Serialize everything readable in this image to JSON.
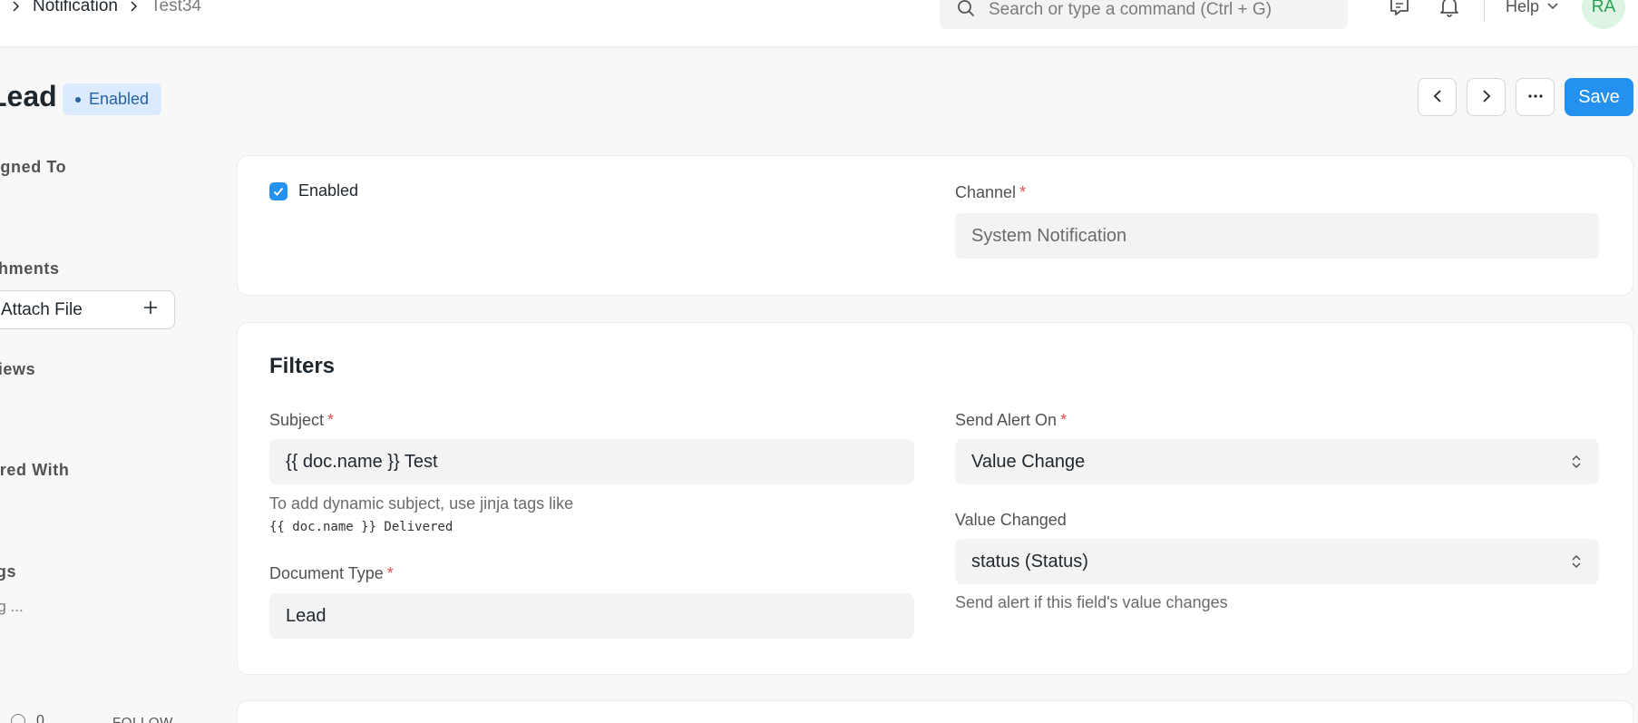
{
  "navbar": {
    "breadcrumb": [
      "Notification",
      "Test34"
    ],
    "search_placeholder": "Search or type a command (Ctrl + G)",
    "help_label": "Help",
    "avatar_initials": "RA"
  },
  "header": {
    "title": "Lead",
    "status": "Enabled"
  },
  "sidebar": {
    "assigned_to": "Assigned To",
    "attachments": "Attachments",
    "attach_file": "Attach File",
    "reviews": "Reviews",
    "shared_with": "Shared With",
    "tags": "Tags",
    "add_tag": "Add a tag ...",
    "like_count": "0",
    "follow": "FOLLOW"
  },
  "actions": {
    "save": "Save"
  },
  "general": {
    "enabled_label": "Enabled",
    "enabled_checked": true,
    "channel_label": "Channel",
    "channel_value": "System Notification"
  },
  "filters": {
    "title": "Filters",
    "subject_label": "Subject",
    "subject_value": "{{ doc.name }} Test",
    "subject_help": "To add dynamic subject, use jinja tags like",
    "subject_example": "{{ doc.name }} Delivered",
    "doctype_label": "Document Type",
    "doctype_value": "Lead",
    "send_alert_label": "Send Alert On",
    "send_alert_value": "Value Change",
    "value_changed_label": "Value Changed",
    "value_changed_value": "status (Status)",
    "value_changed_help": "Send alert if this field's value changes"
  },
  "colors": {
    "primary": "#2490ef",
    "required": "#e24c4c",
    "badge_bg": "#dbeafe",
    "badge_text": "#2563a8"
  }
}
